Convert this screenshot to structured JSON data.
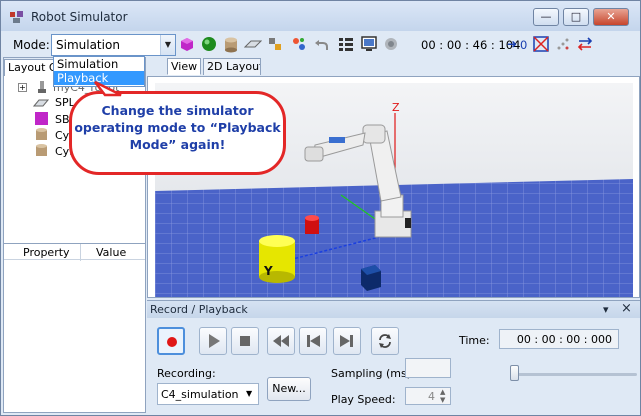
{
  "window": {
    "title": "Robot Simulator"
  },
  "toolbar": {
    "mode_label": "Mode:",
    "mode_value": "Simulation",
    "time": "00 : 00 : 46 : 104",
    "arrow_value": "0",
    "icons": [
      "box-icon",
      "sphere-icon",
      "cylinder-icon",
      "plane-icon",
      "drag-icon",
      "pick-icon",
      "undo-icon",
      "grid-icon",
      "monitor-icon",
      "camera-icon",
      "frame-icon",
      "cross-icon",
      "dots-icon",
      "swap-icon"
    ]
  },
  "mode_dropdown": {
    "options": [
      "Simulation",
      "Playback"
    ],
    "selected": "Playback"
  },
  "left_panel": {
    "tab_label": "Layout O",
    "tree_items": [
      "myC4_robot",
      "SPL",
      "SBo",
      "Cyli",
      "Cyli"
    ],
    "columns": [
      "Property",
      "Value"
    ]
  },
  "view_tabs": [
    "View",
    "2D Layout"
  ],
  "callout": {
    "text": "Change the simulator operating mode to “Playback Mode” again!"
  },
  "scene": {
    "axis_z": "Z",
    "axis_y": "Y"
  },
  "record_panel": {
    "title": "Record / Playback",
    "pin": "▾",
    "close": "×",
    "time_label": "Time:",
    "time_value": "00 : 00 : 00 : 000",
    "recording_label": "Recording:",
    "recording_value": "C4_simulation",
    "new_button": "New...",
    "sampling_label": "Sampling (ms):",
    "sampling_value": "",
    "play_speed_label": "Play Speed:",
    "play_speed_value": "4"
  },
  "colors": {
    "accent": "#3399ff",
    "callout_border": "#e32727",
    "callout_text": "#1f3fa8",
    "floor": "#4a63c8"
  }
}
